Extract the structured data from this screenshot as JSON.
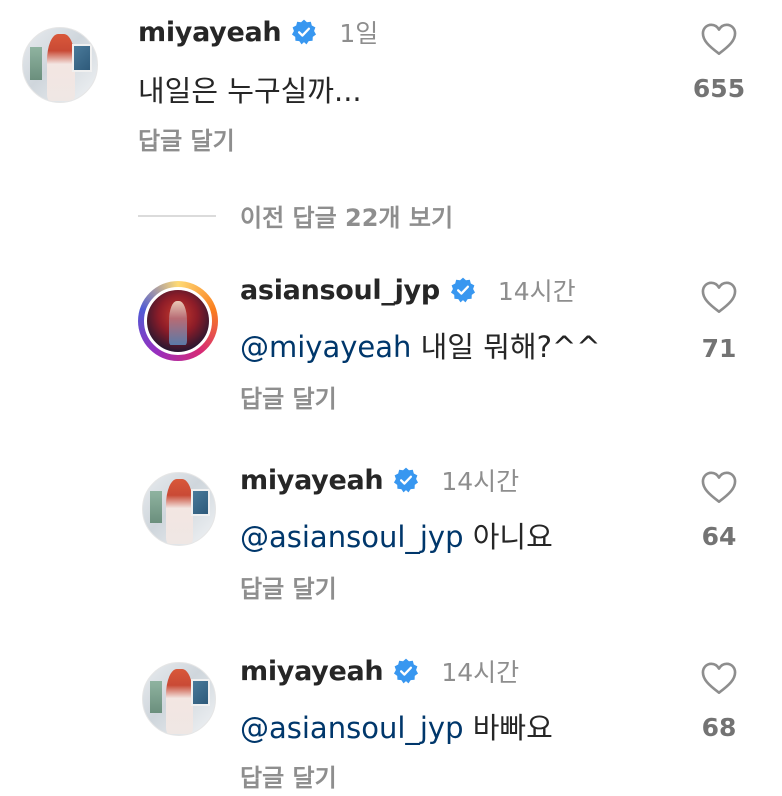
{
  "comments": [
    {
      "username": "miyayeah",
      "time": "1일",
      "mention": "",
      "text": "내일은 누구실까...",
      "reply_label": "답글 달기",
      "likes": "655"
    },
    {
      "username": "asiansoul_jyp",
      "time": "14시간",
      "mention": "@miyayeah",
      "text": " 내일 뭐해?^^",
      "reply_label": "답글 달기",
      "likes": "71"
    },
    {
      "username": "miyayeah",
      "time": "14시간",
      "mention": "@asiansoul_jyp",
      "text": " 아니요",
      "reply_label": "답글 달기",
      "likes": "64"
    },
    {
      "username": "miyayeah",
      "time": "14시간",
      "mention": "@asiansoul_jyp",
      "text": " 바빠요",
      "reply_label": "답글 달기",
      "likes": "68"
    }
  ],
  "view_replies_label": "이전 답글 22개 보기",
  "icons": {
    "verified": "verified-badge-icon",
    "like": "heart-outline-icon"
  },
  "colors": {
    "verified_blue": "#3897f0",
    "mention_blue": "#00376b",
    "secondary_text": "#8e8e8e"
  }
}
